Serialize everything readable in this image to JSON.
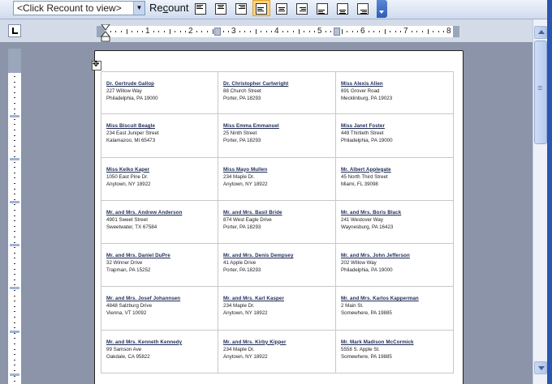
{
  "toolbar": {
    "view_dropdown": "<Click Recount to view>",
    "recount_label": "Recount",
    "align_buttons": [
      "align-top-left",
      "align-top-center",
      "align-top-right",
      "align-center-left",
      "align-center",
      "align-center-right",
      "align-bottom-left",
      "align-bottom-center",
      "align-bottom-right"
    ],
    "active_align": 3
  },
  "ruler": {
    "numbers": [
      "1",
      "2",
      "3",
      "4",
      "5",
      "6",
      "7",
      "8"
    ]
  },
  "labels": [
    [
      {
        "name": "Dr. Gertrude Gallop",
        "street": "227 Willow Way",
        "city": "Philadelphia, PA  19000"
      },
      {
        "name": "Dr. Christopher Cartwright",
        "street": "88 Church Street",
        "city": "Porter, PA  18293"
      },
      {
        "name": "Miss Alexis Allen",
        "street": "891 Grover Road",
        "city": "Mecklinburg, PA  19023"
      }
    ],
    [
      {
        "name": "Miss Biscuit Beagle",
        "street": "234 East Juniper Street",
        "city": "Kalamazoo, MI  65473"
      },
      {
        "name": "Miss Emma Emmanuel",
        "street": "25 Ninth Street",
        "city": "Porter, PA  18293"
      },
      {
        "name": "Miss Janet Foster",
        "street": "449 Thirtieth Street",
        "city": "Philadelphia, PA  19000"
      }
    ],
    [
      {
        "name": "Miss Keiko Kaper",
        "street": "1050 East Pine Dr.",
        "city": "Anytown, NY  18922"
      },
      {
        "name": "Miss Mayo Mullen",
        "street": "234 Maple Dr.",
        "city": "Anytown, NY  18922"
      },
      {
        "name": "Mr. Albert Applegate",
        "street": "45 North Third Street",
        "city": "Miami, FL  39098"
      }
    ],
    [
      {
        "name": "Mr. and Mrs. Andrew Anderson",
        "street": "4901 Sweet Street",
        "city": "Sweetwater, TX  67584"
      },
      {
        "name": "Mr. and Mrs. Basil Bride",
        "street": "874 West Eagle Drive",
        "city": "Porter, PA  18293"
      },
      {
        "name": "Mr. and Mrs. Boris Black",
        "street": "241 Westover Way",
        "city": "Waynesburg, PA  16423"
      }
    ],
    [
      {
        "name": "Mr. and Mrs. Daniel DuPre",
        "street": "32 Winner Drive",
        "city": "Trapman, PA  15252"
      },
      {
        "name": "Mr. and Mrs. Denis Dempsey",
        "street": "41 Apple Drive",
        "city": "Porter, PA  18293"
      },
      {
        "name": "Mr. and Mrs. John Jefferson",
        "street": "202 Willow Way",
        "city": "Philadelphia, PA  19000"
      }
    ],
    [
      {
        "name": "Mr. and Mrs. Josef Johannsen",
        "street": "4848 Salzburg Drive",
        "city": "Vienna, VT  10092"
      },
      {
        "name": "Mr. and Mrs. Karl Kasper",
        "street": "234 Maple Dr.",
        "city": "Anytown, NY  18922"
      },
      {
        "name": "Mr. and Mrs. Karlos Kapperman",
        "street": "2 Main St.",
        "city": "Somewhere, PA  19885"
      }
    ],
    [
      {
        "name": "Mr. and Mrs. Kenneth Kennedy",
        "street": "99 Samson Ave",
        "city": "Oakdale, CA  95822"
      },
      {
        "name": "Mr. and Mrs. Kirby Kipper",
        "street": "234 Maple Dr.",
        "city": "Anytown, NY  18922"
      },
      {
        "name": "Mr. Mark Madison McCormick",
        "street": "5558 S. Apple St.",
        "city": "Somewhere, PA  19885"
      }
    ]
  ]
}
